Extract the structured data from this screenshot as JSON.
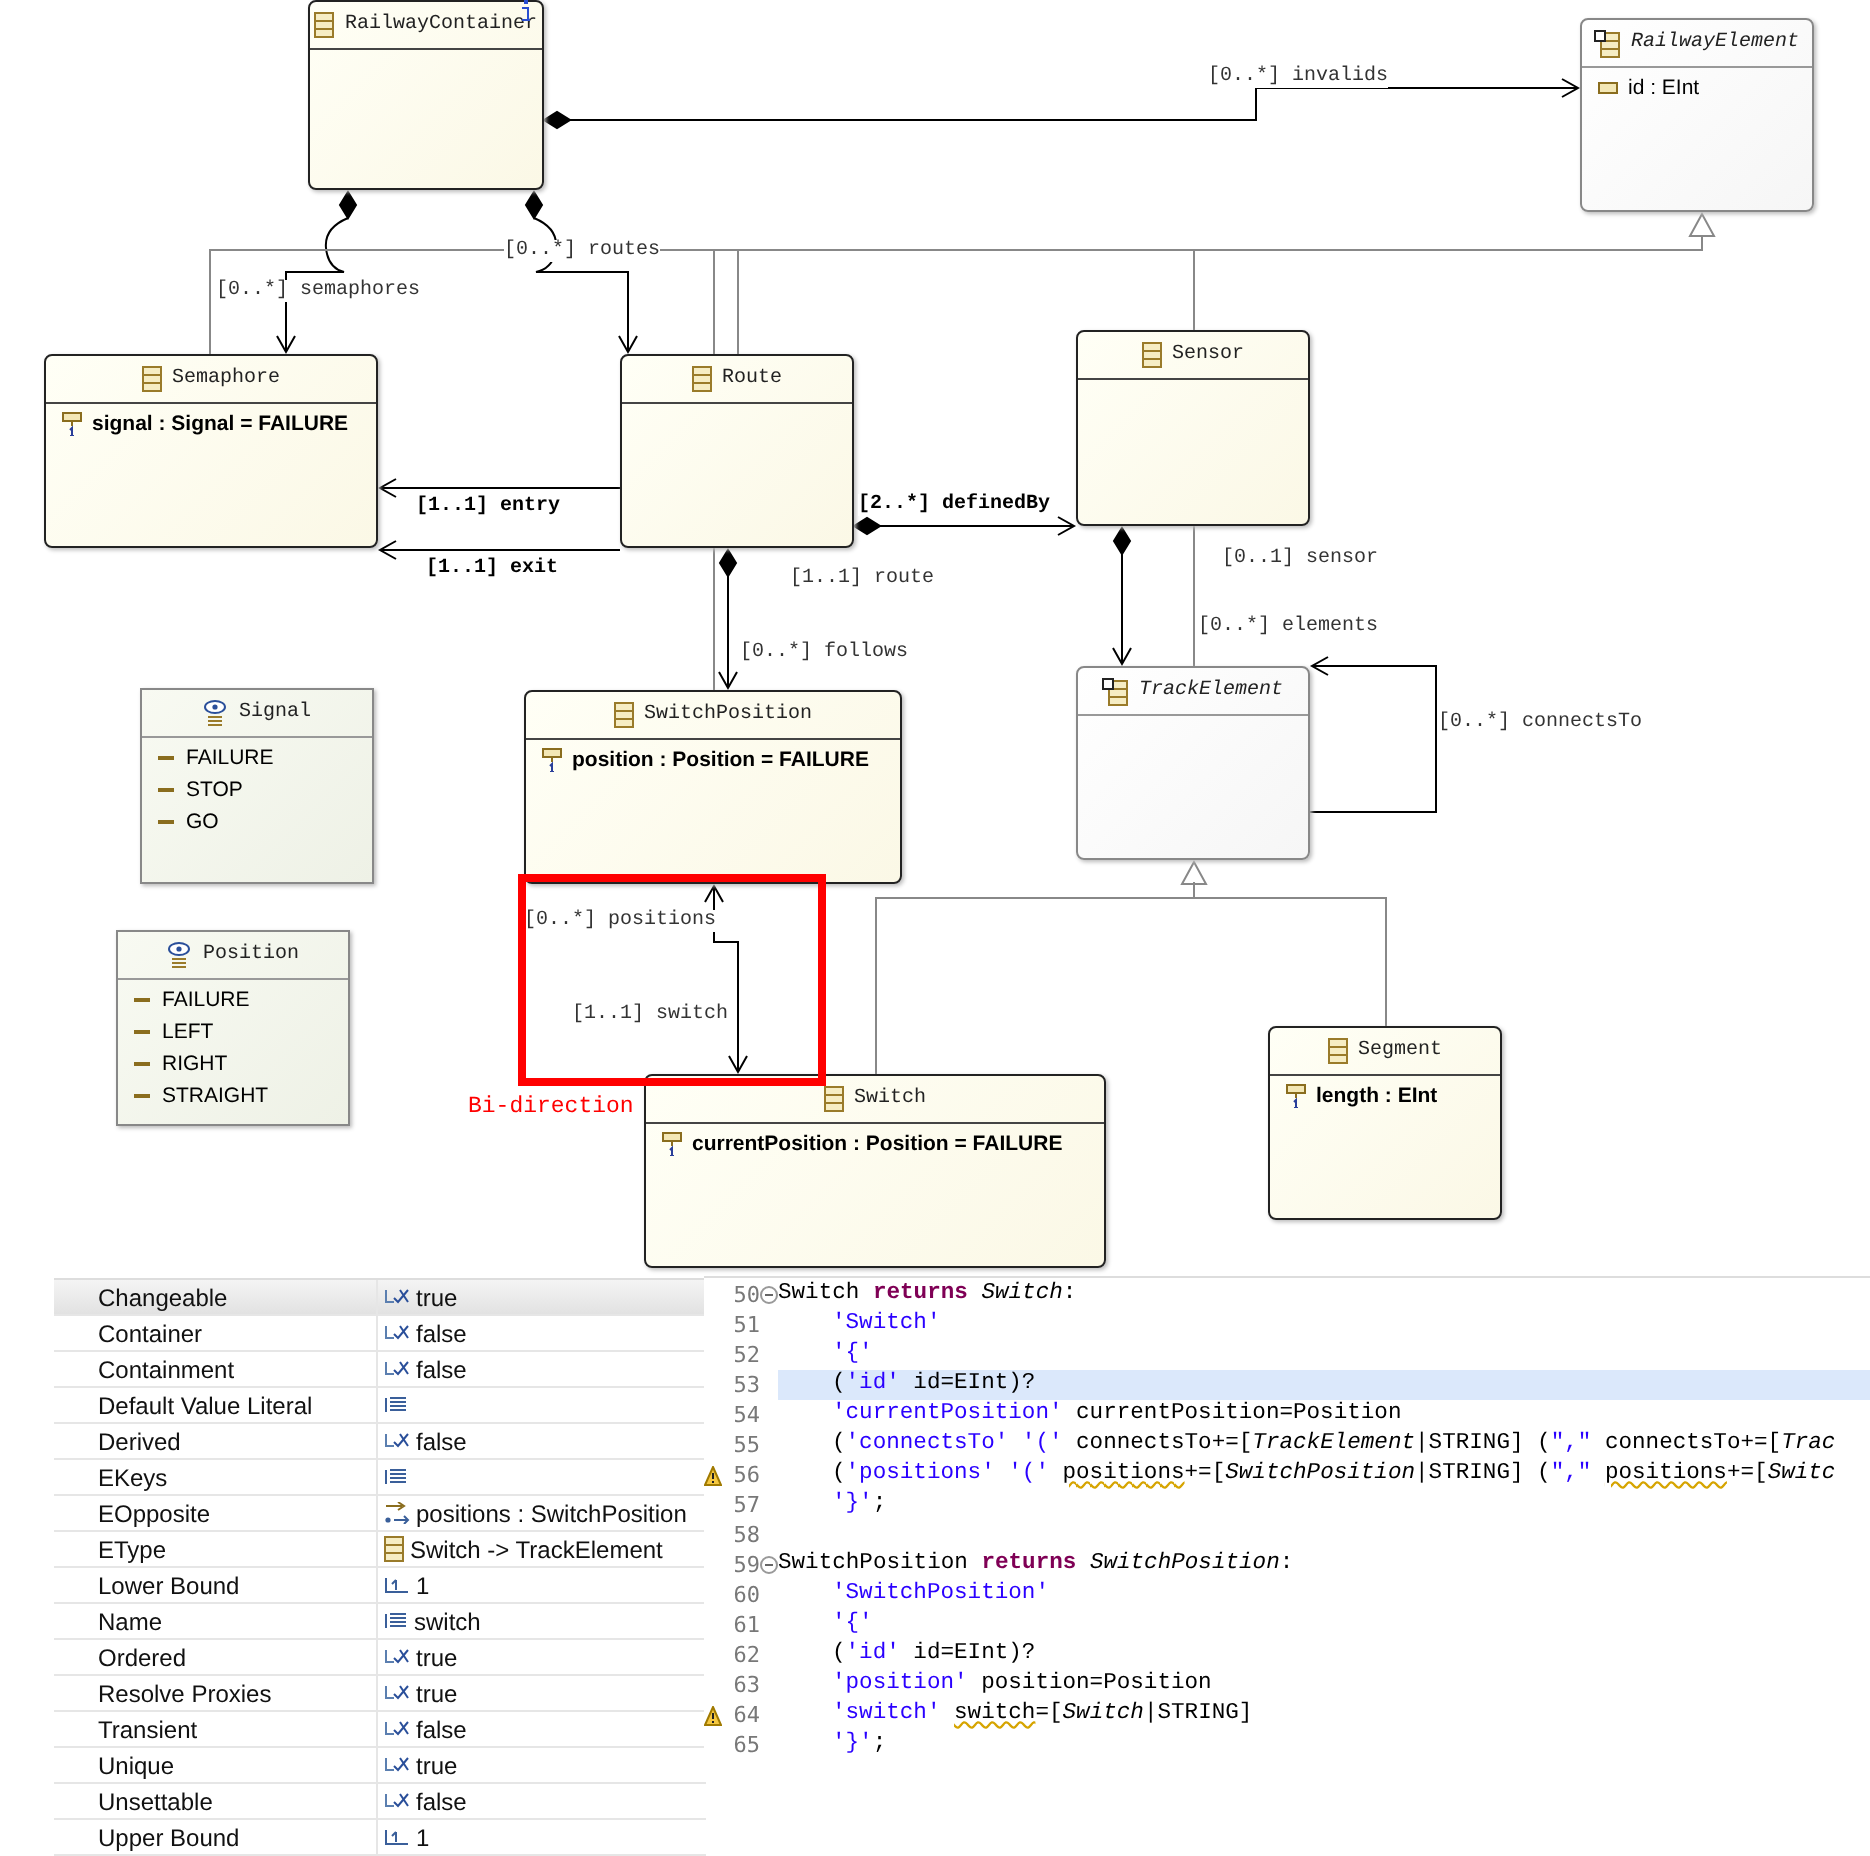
{
  "diagram": {
    "nodes": [
      {
        "kind": "class",
        "name": "RailwayContainer"
      },
      {
        "kind": "abstract",
        "name": "RailwayElement",
        "attributes": [
          {
            "text": "id : EInt",
            "kind": "optional"
          }
        ]
      },
      {
        "kind": "class",
        "name": "Semaphore",
        "attributes": [
          {
            "text": "signal : Signal = FAILURE",
            "kind": "required"
          }
        ]
      },
      {
        "kind": "class",
        "name": "Route"
      },
      {
        "kind": "class",
        "name": "Sensor"
      },
      {
        "kind": "enum",
        "name": "Signal",
        "literals": [
          "FAILURE",
          "STOP",
          "GO"
        ]
      },
      {
        "kind": "class",
        "name": "SwitchPosition",
        "attributes": [
          {
            "text": "position : Position = FAILURE",
            "kind": "required"
          }
        ]
      },
      {
        "kind": "abstract",
        "name": "TrackElement"
      },
      {
        "kind": "enum",
        "name": "Position",
        "literals": [
          "FAILURE",
          "LEFT",
          "RIGHT",
          "STRAIGHT"
        ]
      },
      {
        "kind": "class",
        "name": "Switch",
        "attributes": [
          {
            "text": "currentPosition : Position = FAILURE",
            "kind": "required"
          }
        ]
      },
      {
        "kind": "class",
        "name": "Segment",
        "attributes": [
          {
            "text": "length : EInt",
            "kind": "required"
          }
        ]
      }
    ],
    "edges": [
      {
        "kind": "containment",
        "labels": [
          {
            "text": "[0..*] invalids",
            "bold": false
          }
        ]
      },
      {
        "kind": "containment",
        "labels": [
          {
            "text": "[0..*] semaphores",
            "bold": false
          }
        ]
      },
      {
        "kind": "containment",
        "labels": [
          {
            "text": "[0..*] routes",
            "bold": false
          }
        ]
      },
      {
        "kind": "reference",
        "labels": [
          {
            "text": "[1..1] entry",
            "bold": true
          }
        ]
      },
      {
        "kind": "reference",
        "labels": [
          {
            "text": "[1..1] exit",
            "bold": true
          }
        ]
      },
      {
        "kind": "containment",
        "labels": [
          {
            "text": "[2..*] definedBy",
            "bold": true
          }
        ]
      },
      {
        "kind": "containment",
        "labels": [
          {
            "text": "[1..1] route",
            "bold": false
          },
          {
            "text": "[0..*] follows",
            "bold": false
          }
        ]
      },
      {
        "kind": "containment",
        "labels": [
          {
            "text": "[0..1] sensor",
            "bold": false
          },
          {
            "text": "[0..*] elements",
            "bold": false
          }
        ]
      },
      {
        "kind": "reference",
        "labels": [
          {
            "text": "[0..*] connectsTo",
            "bold": false
          }
        ]
      },
      {
        "kind": "bidirectional",
        "labels": [
          {
            "text": "[0..*] positions",
            "bold": false
          },
          {
            "text": "[1..1] switch",
            "bold": false
          }
        ]
      },
      {
        "kind": "inheritance"
      },
      {
        "kind": "inheritance"
      }
    ],
    "annotation": {
      "text": "Bi-direction"
    }
  },
  "properties": {
    "rows": [
      {
        "name": "Changeable",
        "kind": "boolean",
        "value": "true",
        "selected": true
      },
      {
        "name": "Container",
        "kind": "boolean",
        "value": "false",
        "selected": false
      },
      {
        "name": "Containment",
        "kind": "boolean",
        "value": "false",
        "selected": false
      },
      {
        "name": "Default Value Literal",
        "kind": "text",
        "selected": false
      },
      {
        "name": "Derived",
        "kind": "boolean",
        "value": "false",
        "selected": false
      },
      {
        "name": "EKeys",
        "kind": "text",
        "selected": false
      },
      {
        "name": "EOpposite",
        "kind": "reference",
        "value": "positions : SwitchPosition",
        "selected": false
      },
      {
        "name": "EType",
        "kind": "class",
        "value": "Switch -> TrackElement",
        "selected": false
      },
      {
        "name": "Lower Bound",
        "kind": "number",
        "value": "1",
        "selected": false
      },
      {
        "name": "Name",
        "kind": "text",
        "value": "switch",
        "selected": false
      },
      {
        "name": "Ordered",
        "kind": "boolean",
        "value": "true",
        "selected": false
      },
      {
        "name": "Resolve Proxies",
        "kind": "boolean",
        "value": "true",
        "selected": false
      },
      {
        "name": "Transient",
        "kind": "boolean",
        "value": "false",
        "selected": false
      },
      {
        "name": "Unique",
        "kind": "boolean",
        "value": "true",
        "selected": false
      },
      {
        "name": "Unsettable",
        "kind": "boolean",
        "value": "false",
        "selected": false
      },
      {
        "name": "Upper Bound",
        "kind": "number",
        "value": "1",
        "selected": false
      }
    ]
  },
  "editor": {
    "lines": [
      {
        "number": "50",
        "fold": true,
        "warning": false,
        "highlighted": false,
        "indented": false,
        "tokens": [
          {
            "kind": "plain",
            "text": "Switch "
          },
          {
            "kind": "keyword",
            "text": "returns "
          },
          {
            "kind": "type",
            "text": "Switch"
          },
          {
            "kind": "plain",
            "text": ":"
          }
        ]
      },
      {
        "number": "51",
        "fold": false,
        "warning": false,
        "highlighted": false,
        "indented": true,
        "tokens": [
          {
            "kind": "string",
            "text": "'Switch'"
          }
        ]
      },
      {
        "number": "52",
        "fold": false,
        "warning": false,
        "highlighted": false,
        "indented": true,
        "tokens": [
          {
            "kind": "string",
            "text": "'{'"
          }
        ]
      },
      {
        "number": "53",
        "fold": false,
        "warning": false,
        "highlighted": true,
        "indented": true,
        "tokens": [
          {
            "kind": "plain",
            "text": "("
          },
          {
            "kind": "string",
            "text": "'id'"
          },
          {
            "kind": "plain",
            "text": " id=EInt)?"
          }
        ]
      },
      {
        "number": "54",
        "fold": false,
        "warning": false,
        "highlighted": false,
        "indented": true,
        "tokens": [
          {
            "kind": "string",
            "text": "'currentPosition'"
          },
          {
            "kind": "plain",
            "text": " currentPosition=Position"
          }
        ]
      },
      {
        "number": "55",
        "fold": false,
        "warning": false,
        "highlighted": false,
        "indented": true,
        "tokens": [
          {
            "kind": "plain",
            "text": "("
          },
          {
            "kind": "string",
            "text": "'connectsTo' '('"
          },
          {
            "kind": "plain",
            "text": " connectsTo+=["
          },
          {
            "kind": "type",
            "text": "TrackElement"
          },
          {
            "kind": "plain",
            "text": "|STRING] ("
          },
          {
            "kind": "string",
            "text": "\",\""
          },
          {
            "kind": "plain",
            "text": " connectsTo+=["
          },
          {
            "kind": "type",
            "text": "Trac"
          }
        ]
      },
      {
        "number": "56",
        "fold": false,
        "warning": true,
        "highlighted": false,
        "indented": true,
        "tokens": [
          {
            "kind": "plain",
            "text": "("
          },
          {
            "kind": "string",
            "text": "'positions' '(' "
          },
          {
            "kind": "squiggle",
            "text": "positions"
          },
          {
            "kind": "plain",
            "text": "+=["
          },
          {
            "kind": "type",
            "text": "SwitchPosition"
          },
          {
            "kind": "plain",
            "text": "|STRING] ("
          },
          {
            "kind": "string",
            "text": "\",\" "
          },
          {
            "kind": "squiggle",
            "text": "positions"
          },
          {
            "kind": "plain",
            "text": "+=["
          },
          {
            "kind": "type",
            "text": "Switc"
          }
        ]
      },
      {
        "number": "57",
        "fold": false,
        "warning": false,
        "highlighted": false,
        "indented": true,
        "tokens": [
          {
            "kind": "string",
            "text": "'}'"
          },
          {
            "kind": "plain",
            "text": ";"
          }
        ]
      },
      {
        "number": "58",
        "fold": false,
        "warning": false
      },
      {
        "number": "59",
        "fold": true,
        "warning": false,
        "highlighted": false,
        "indented": false,
        "tokens": [
          {
            "kind": "plain",
            "text": "SwitchPosition "
          },
          {
            "kind": "keyword",
            "text": "returns "
          },
          {
            "kind": "type",
            "text": "SwitchPosition"
          },
          {
            "kind": "plain",
            "text": ":"
          }
        ]
      },
      {
        "number": "60",
        "fold": false,
        "warning": false,
        "highlighted": false,
        "indented": true,
        "tokens": [
          {
            "kind": "string",
            "text": "'SwitchPosition'"
          }
        ]
      },
      {
        "number": "61",
        "fold": false,
        "warning": false,
        "highlighted": false,
        "indented": true,
        "tokens": [
          {
            "kind": "string",
            "text": "'{'"
          }
        ]
      },
      {
        "number": "62",
        "fold": false,
        "warning": false,
        "highlighted": false,
        "indented": true,
        "tokens": [
          {
            "kind": "plain",
            "text": "("
          },
          {
            "kind": "string",
            "text": "'id'"
          },
          {
            "kind": "plain",
            "text": " id=EInt)?"
          }
        ]
      },
      {
        "number": "63",
        "fold": false,
        "warning": false,
        "highlighted": false,
        "indented": true,
        "tokens": [
          {
            "kind": "string",
            "text": "'position'"
          },
          {
            "kind": "plain",
            "text": " position=Position"
          }
        ]
      },
      {
        "number": "64",
        "fold": false,
        "warning": true,
        "highlighted": false,
        "indented": true,
        "tokens": [
          {
            "kind": "string",
            "text": "'switch' "
          },
          {
            "kind": "squiggle",
            "text": "switch"
          },
          {
            "kind": "plain",
            "text": "=["
          },
          {
            "kind": "type",
            "text": "Switch"
          },
          {
            "kind": "plain",
            "text": "|STRING]"
          }
        ]
      },
      {
        "number": "65",
        "fold": false,
        "warning": false,
        "highlighted": false,
        "indented": true,
        "tokens": [
          {
            "kind": "string",
            "text": "'}'"
          },
          {
            "kind": "plain",
            "text": ";"
          }
        ]
      }
    ]
  }
}
